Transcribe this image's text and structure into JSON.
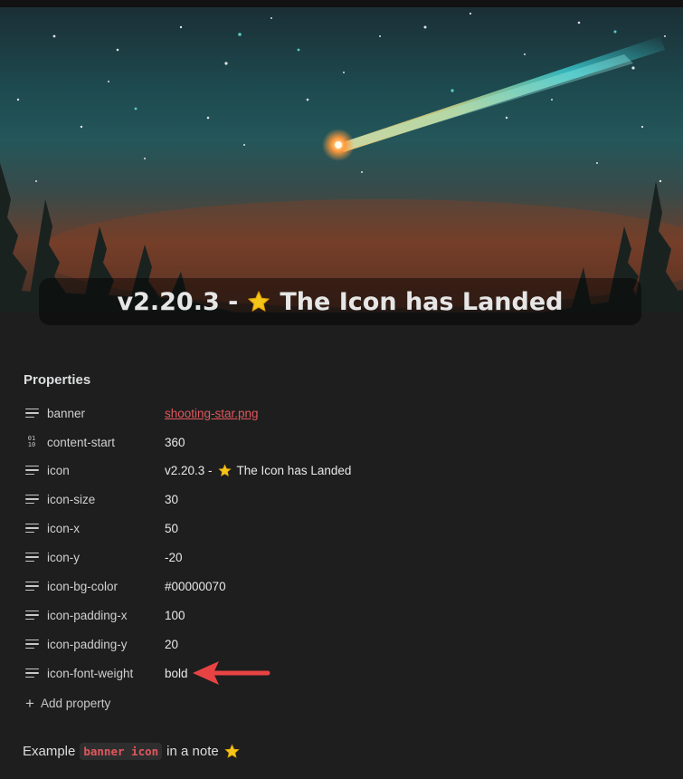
{
  "banner": {
    "icon_text": "v2.20.3 -  The Icon has Landed",
    "icon_prefix": "v2.20.3 -",
    "icon_suffix": "The Icon has Landed",
    "icon_emoji": "star-icon"
  },
  "properties": {
    "title": "Properties",
    "rows": [
      {
        "key": "banner",
        "value": "shooting-star.png",
        "type": "text",
        "link": true
      },
      {
        "key": "content-start",
        "value": "360",
        "type": "number"
      },
      {
        "key": "icon",
        "value_prefix": "v2.20.3 -",
        "value_suffix": "The Icon has Landed",
        "type": "text"
      },
      {
        "key": "icon-size",
        "value": "30",
        "type": "text"
      },
      {
        "key": "icon-x",
        "value": "50",
        "type": "text"
      },
      {
        "key": "icon-y",
        "value": "-20",
        "type": "text"
      },
      {
        "key": "icon-bg-color",
        "value": "#00000070",
        "type": "text"
      },
      {
        "key": "icon-padding-x",
        "value": "100",
        "type": "text"
      },
      {
        "key": "icon-padding-y",
        "value": "20",
        "type": "text"
      },
      {
        "key": "icon-font-weight",
        "value": "bold",
        "type": "text"
      }
    ],
    "add_label": "Add property"
  },
  "example": {
    "prefix": "Example",
    "code": "banner icon",
    "suffix": "in a note"
  },
  "colors": {
    "accent_red": "#e0575d",
    "background": "#1e1e1e",
    "arrow": "#e84343",
    "star": "#f5c518"
  }
}
